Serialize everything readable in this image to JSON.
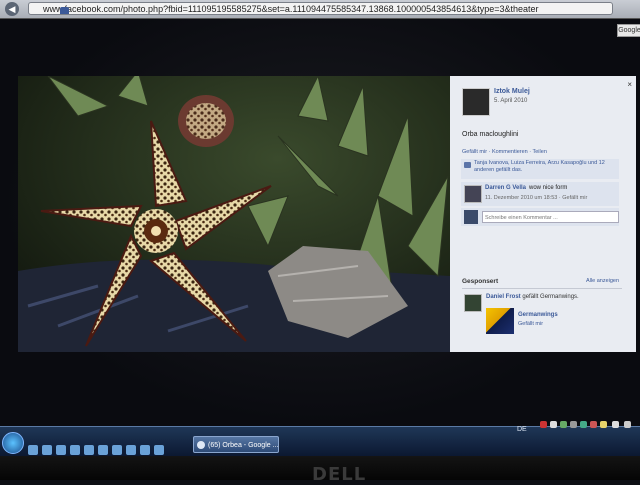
{
  "browser": {
    "url": "www.facebook.com/photo.php?fbid=111095195585275&set=a.111094475585347.13868.100000543854613&type=3&theater",
    "search_box": "Google"
  },
  "photo_panel": {
    "close_label": "×",
    "author": "Iztok Mulej",
    "date": "5. April 2010",
    "caption": "Orba macloughlini",
    "actions": "Gefällt mir · Kommentieren · Teilen",
    "likes": "Tanja Ivanova, Luiza Ferreira, Arzu Kasapoğlu und 12 anderen gefällt das.",
    "comment": {
      "author": "Darren G Vella",
      "text": "wow nice form",
      "meta": "11. Dezember 2010 um 18:53 · Gefällt mir"
    },
    "write_placeholder": "Schreibe einen Kommentar ...",
    "sponsored": {
      "heading": "Gesponsert",
      "see_all": "Alle anzeigen",
      "line_author": "Daniel Frost",
      "line_text": "gefällt Germanwings.",
      "ad_title": "Germanwings",
      "ad_like": "Gefällt mir"
    }
  },
  "taskbar": {
    "active_window": "(65) Orbea - Google ...",
    "language": "DE"
  },
  "monitor": {
    "brand": "DELL"
  }
}
